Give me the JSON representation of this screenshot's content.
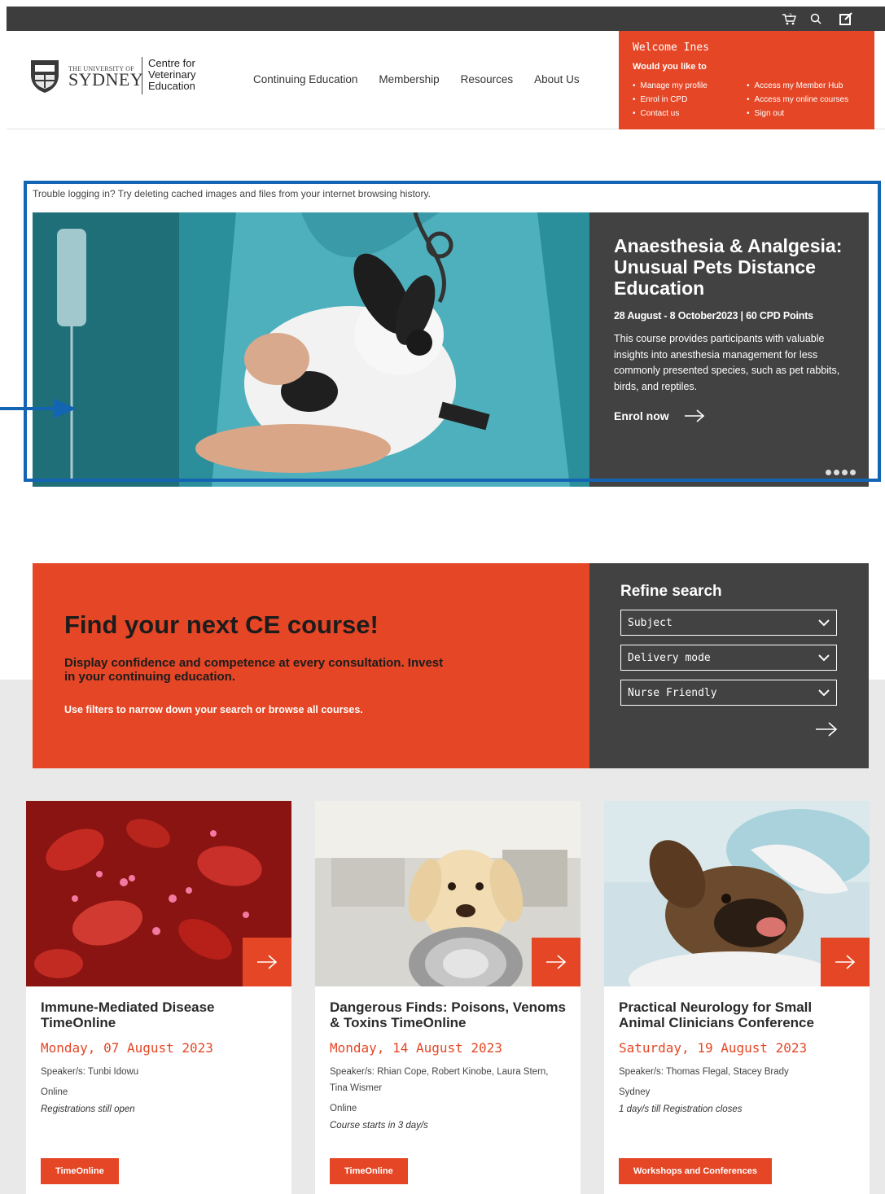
{
  "header": {
    "uni_small": "THE UNIVERSITY OF",
    "uni_name": "SYDNEY",
    "centre_name": "Centre for Veterinary Education",
    "nav": [
      "Continuing Education",
      "Membership",
      "Resources",
      "About Us"
    ],
    "topbar_icons": [
      "cart-icon",
      "search-icon",
      "edit-icon"
    ]
  },
  "welcome": {
    "title": "Welcome Ines",
    "subtitle": "Would you like to",
    "left_links": [
      "Manage my profile",
      "Enrol in CPD",
      "Contact us"
    ],
    "right_links": [
      "Access my Member Hub",
      "Access my online courses",
      "Sign out"
    ]
  },
  "hero": {
    "notice": "Trouble logging in? Try deleting cached images and files from your internet browsing history.",
    "title": "Anaesthesia & Analgesia: Unusual Pets Distance Education",
    "dates": "28 August - 8 October2023 | 60 CPD Points",
    "description": "This course provides participants with valuable insights into anesthesia management for less commonly presented species, such as pet rabbits, birds, and reptiles.",
    "cta": "Enrol now",
    "slide_count": 4
  },
  "find": {
    "title": "Find your next CE course!",
    "subtitle": "Display confidence and competence at every consultation. Invest in your continuing education.",
    "note": "Use filters to narrow down your search or browse all courses."
  },
  "refine": {
    "title": "Refine search",
    "filters": [
      "Subject",
      "Delivery mode",
      "Nurse Friendly"
    ]
  },
  "cards": [
    {
      "title": "Immune-Mediated Disease TimeOnline",
      "date": "Monday, 07 August 2023",
      "speakers": "Speaker/s: Tunbi Idowu",
      "location": "Online",
      "status": "Registrations still open",
      "tag": "TimeOnline"
    },
    {
      "title": "Dangerous Finds: Poisons, Venoms & Toxins TimeOnline",
      "date": "Monday, 14 August 2023",
      "speakers": "Speaker/s: Rhian Cope, Robert Kinobe, Laura Stern, Tina Wismer",
      "location": "Online",
      "status": "Course starts in 3 day/s",
      "tag": "TimeOnline"
    },
    {
      "title": "Practical Neurology for Small Animal Clinicians Conference",
      "date": "Saturday, 19 August 2023",
      "speakers": "Speaker/s: Thomas Flegal, Stacey Brady",
      "location": "Sydney",
      "status": "1 day/s till Registration closes",
      "tag": "Workshops and Conferences"
    }
  ],
  "colors": {
    "accent": "#e54625",
    "dark_panel": "#424242",
    "topbar": "#3d3d3d",
    "highlight": "#1464b4"
  }
}
